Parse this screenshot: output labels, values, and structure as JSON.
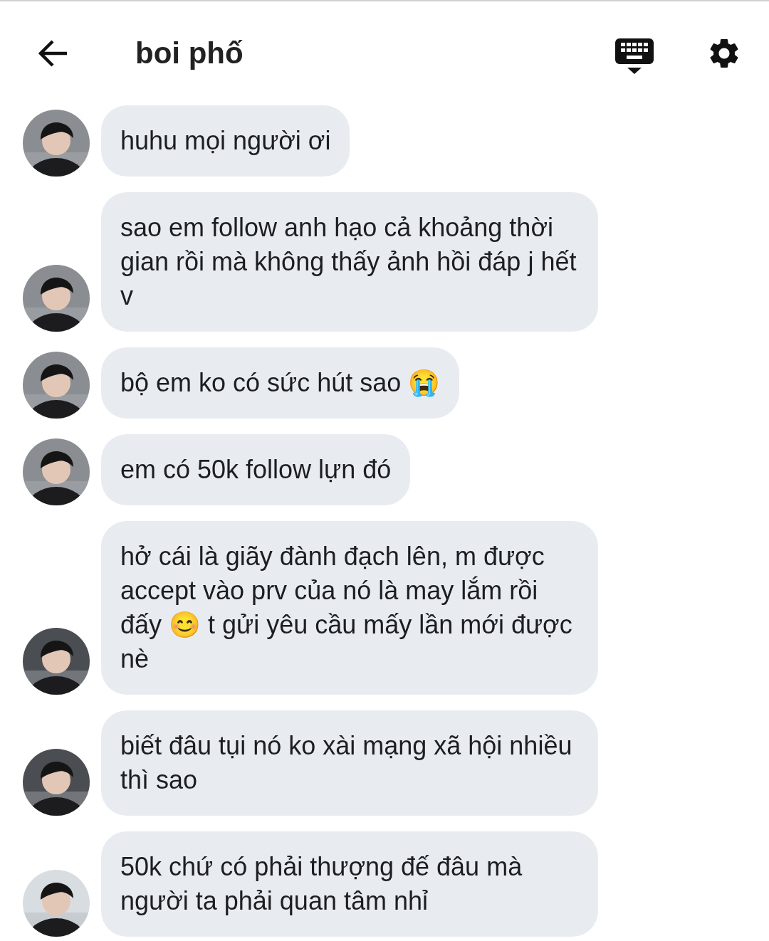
{
  "header": {
    "title": "boi phố"
  },
  "messages": [
    {
      "text": "huhu mọi người ơi"
    },
    {
      "text": "sao em follow anh hạo cả khoảng thời gian rồi mà không thấy ảnh hồi đáp j hết v"
    },
    {
      "text": "bộ em ko có sức hút sao 😭"
    },
    {
      "text": "em có 50k follow lựn đó"
    },
    {
      "text": "hở cái là giãy đành đạch lên, m được accept vào prv của nó là may lắm rồi đấy 😊 t gửi yêu cầu mấy lần mới được nè"
    },
    {
      "text": "biết đâu tụi nó ko xài mạng xã hội nhiều thì sao"
    },
    {
      "text": "50k chứ có phải thượng đế đâu mà người ta phải quan tâm nhỉ"
    }
  ]
}
